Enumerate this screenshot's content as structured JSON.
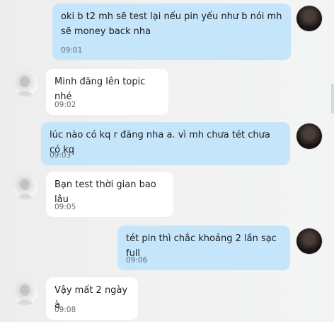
{
  "messages": [
    {
      "sender": "me",
      "text": "oki b t2 mh sẽ test lại nếu pin yếu như b nói mh sẽ money back nha",
      "time": "09:01"
    },
    {
      "sender": "other",
      "text": "Minh đăng lên topic nhé",
      "time": "09:02"
    },
    {
      "sender": "me",
      "text": "lúc nào có kq r đăng nha a. vì mh chưa tét chưa có kq",
      "time": "09:03"
    },
    {
      "sender": "other",
      "text": "Bạn test thời gian bao lâu",
      "time": "09:05"
    },
    {
      "sender": "me",
      "text": "tét pin thì chắc khoảng 2 lần sạc full",
      "time": "09:06"
    },
    {
      "sender": "other",
      "text": "Vậy mất 2 ngày à",
      "time": "09:08"
    }
  ],
  "icons": {
    "my_avatar": "avatar-dark-photo",
    "contact_avatar": "avatar-light-photo"
  },
  "colors": {
    "outgoing_bubble": "#c5e5fb",
    "incoming_bubble": "#ffffff",
    "timestamp": "#5b6a74"
  }
}
